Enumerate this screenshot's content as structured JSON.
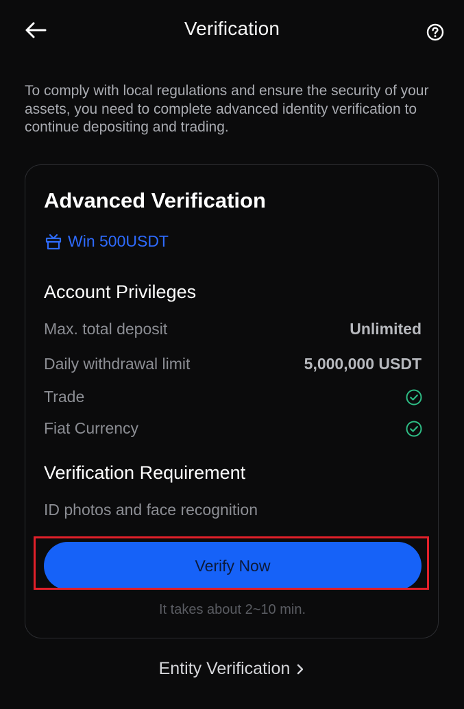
{
  "header": {
    "title": "Verification",
    "back_icon": "arrow-left-icon",
    "help_icon": "question-circle-icon"
  },
  "intro": {
    "text": "To comply with local regulations and ensure the security of your assets, you need to complete advanced identity verification to continue depositing and trading."
  },
  "card": {
    "title": "Advanced Verification",
    "reward": {
      "icon": "gift-icon",
      "label": "Win 500USDT"
    },
    "privileges": {
      "title": "Account Privileges",
      "items": [
        {
          "label": "Max. total deposit",
          "value": "Unlimited"
        },
        {
          "label": "Daily withdrawal limit",
          "value": "5,000,000 USDT"
        },
        {
          "label": "Trade",
          "value": "check-circle-icon"
        },
        {
          "label": "Fiat Currency",
          "value": "check-circle-icon"
        }
      ]
    },
    "requirement": {
      "title": "Verification Requirement",
      "text": "ID photos and face recognition"
    },
    "verify_button": "Verify Now",
    "duration_note": "It takes about 2~10 min."
  },
  "entity_link": {
    "label": "Entity Verification",
    "icon": "chevron-right-icon"
  },
  "colors": {
    "background": "#0b0b0c",
    "accent": "#1662f8",
    "link_blue": "#2e6bff",
    "check_green": "#2ebd85",
    "highlight_red": "#e2202a"
  }
}
